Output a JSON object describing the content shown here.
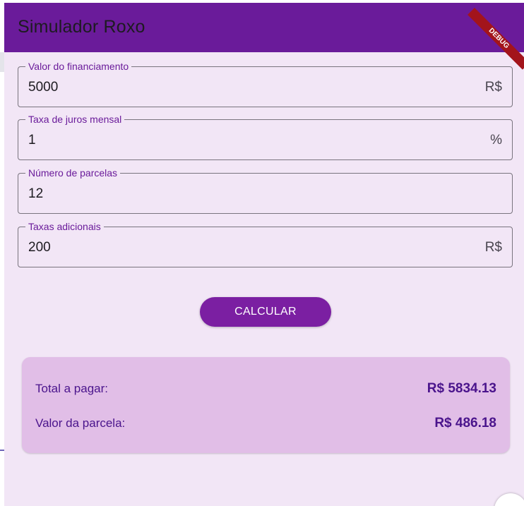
{
  "appbar": {
    "title": "Simulador Roxo",
    "debug_label": "DEBUG"
  },
  "form": {
    "loan_amount": {
      "label": "Valor do financiamento",
      "value": "5000",
      "suffix": "R$"
    },
    "interest_rate": {
      "label": "Taxa de juros mensal",
      "value": "1",
      "suffix": "%"
    },
    "installments": {
      "label": "Número de parcelas",
      "value": "12"
    },
    "additional_fees": {
      "label": "Taxas adicionais",
      "value": "200",
      "suffix": "R$"
    }
  },
  "calculate_button": "CALCULAR",
  "result": {
    "total_label": "Total a pagar:",
    "total_value": "R$ 5834.13",
    "installment_label": "Valor da parcela:",
    "installment_value": "R$ 486.18"
  },
  "colors": {
    "primary": "#6a1b9a",
    "background": "#f2e6f6",
    "result_card": "#e1bee7",
    "result_text": "#4a148c"
  }
}
